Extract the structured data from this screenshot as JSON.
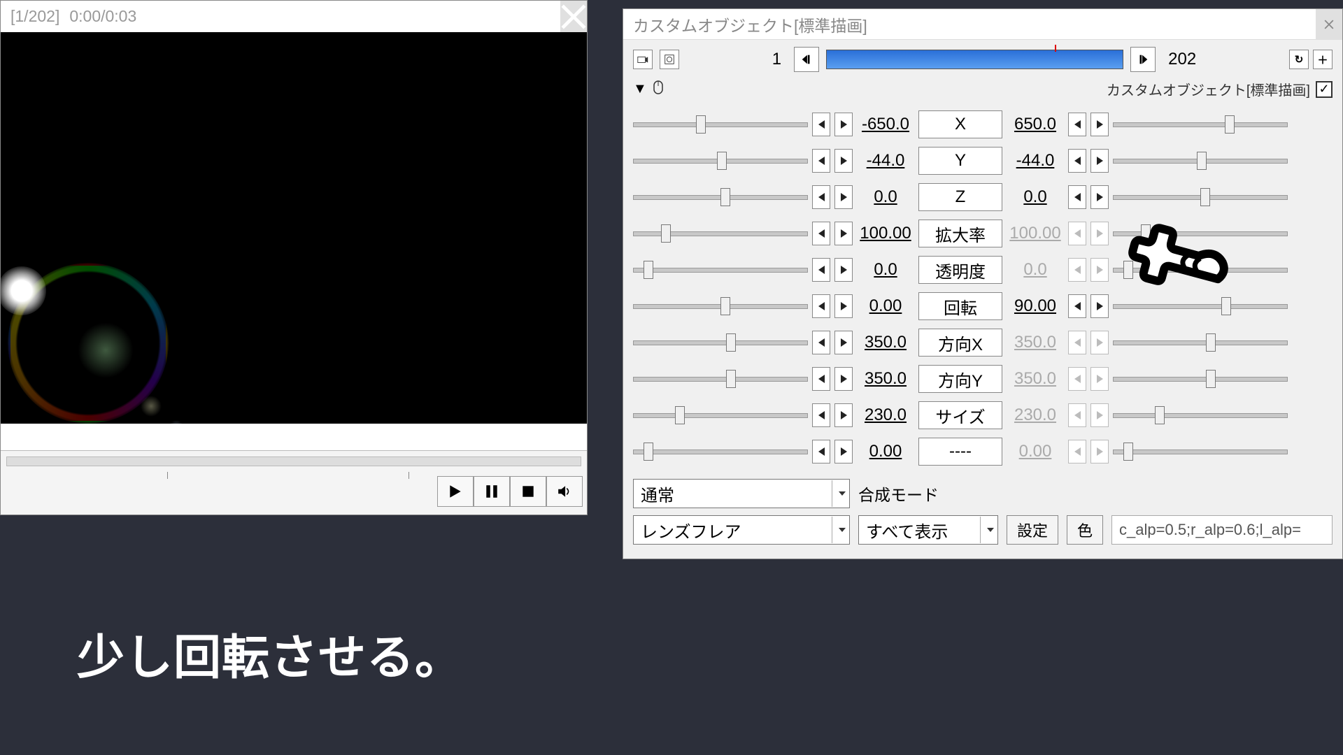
{
  "preview": {
    "title_frames": "[1/202]",
    "title_time": "0:00/0:03"
  },
  "props": {
    "title": "カスタムオブジェクト[標準描画]",
    "frame_start": "1",
    "frame_end": "202",
    "object_label": "カスタムオブジェクト[標準描画]",
    "checked": "✓",
    "params": [
      {
        "label": "X",
        "v1": "-650.0",
        "v2": "650.0",
        "t1": 36,
        "t2": 64,
        "d2": false
      },
      {
        "label": "Y",
        "v1": "-44.0",
        "v2": "-44.0",
        "t1": 48,
        "t2": 48,
        "d2": false
      },
      {
        "label": "Z",
        "v1": "0.0",
        "v2": "0.0",
        "t1": 50,
        "t2": 50,
        "d2": false
      },
      {
        "label": "拡大率",
        "v1": "100.00",
        "v2": "100.00",
        "t1": 16,
        "t2": 16,
        "d2": true
      },
      {
        "label": "透明度",
        "v1": "0.0",
        "v2": "0.0",
        "t1": 6,
        "t2": 6,
        "d2": true
      },
      {
        "label": "回転",
        "v1": "0.00",
        "v2": "90.00",
        "t1": 50,
        "t2": 62,
        "d2": false
      },
      {
        "label": "方向X",
        "v1": "350.0",
        "v2": "350.0",
        "t1": 53,
        "t2": 53,
        "d2": true
      },
      {
        "label": "方向Y",
        "v1": "350.0",
        "v2": "350.0",
        "t1": 53,
        "t2": 53,
        "d2": true
      },
      {
        "label": "サイズ",
        "v1": "230.0",
        "v2": "230.0",
        "t1": 24,
        "t2": 24,
        "d2": true
      },
      {
        "label": "----",
        "v1": "0.00",
        "v2": "0.00",
        "t1": 6,
        "t2": 6,
        "d2": true
      }
    ],
    "blend_mode": "通常",
    "blend_label": "合成モード",
    "effect_type": "レンズフレア",
    "display_mode": "すべて表示",
    "settings_btn": "設定",
    "color_btn": "色",
    "params_string": "c_alp=0.5;r_alp=0.6;l_alp="
  },
  "caption": "少し回転させる。"
}
